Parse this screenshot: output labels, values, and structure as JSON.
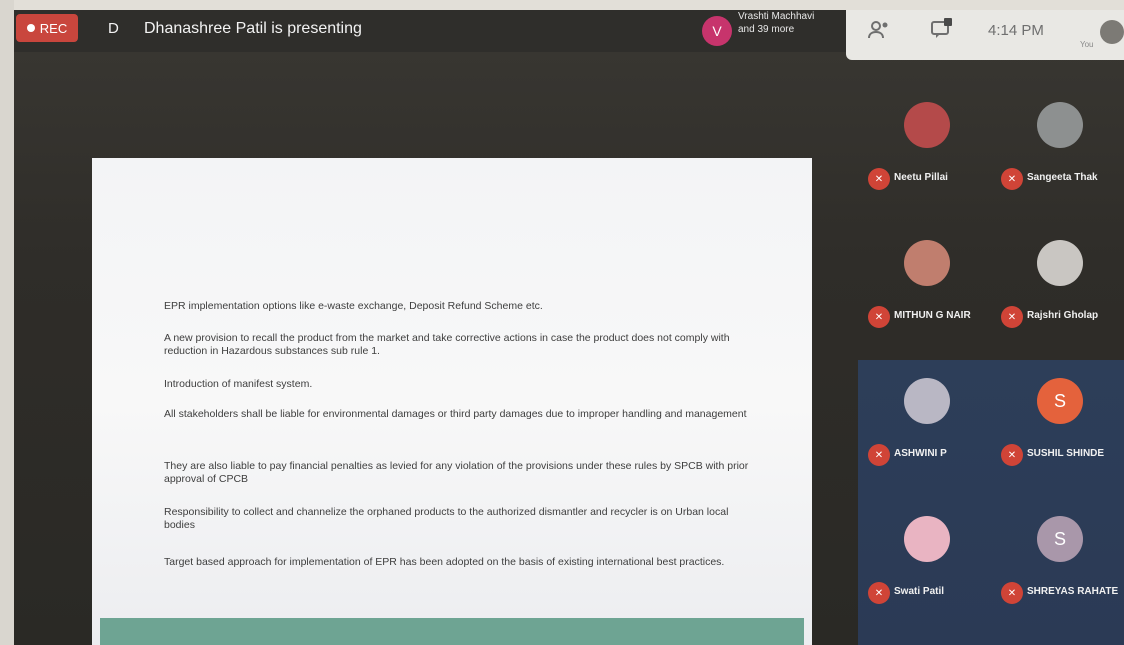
{
  "topbar": {
    "rec_label": "REC",
    "presenter_initial": "D",
    "presenting_text": "Dhanashree Patil is presenting",
    "other_avatar_letter": "V",
    "others_line1": "Vrashti Machhavi",
    "others_line2": "and 39 more"
  },
  "status": {
    "time": "4:14 PM",
    "you_label": "You"
  },
  "slide": {
    "bullets": [
      "EPR implementation options like e-waste exchange, Deposit Refund Scheme etc.",
      "A new provision to recall the product from the market and take corrective actions in case the product does not comply with reduction in Hazardous substances sub rule 1.",
      "Introduction of manifest system.",
      "All stakeholders shall be liable for environmental damages or third party damages due to improper handling and management",
      "They are also liable to pay financial penalties as levied for any violation of the provisions under these rules by SPCB with prior approval of CPCB",
      "Responsibility to collect and channelize the orphaned products to the authorized dismantler and recycler is on Urban local bodies",
      "Target based approach for implementation of EPR has been adopted on the basis of existing international best practices."
    ]
  },
  "participants": [
    {
      "name": "Neetu Pillai",
      "initial": "",
      "color": "#b44a4a"
    },
    {
      "name": "Sangeeta Thak",
      "initial": "",
      "color": "#8d9090"
    },
    {
      "name": "MITHUN G NAIR",
      "initial": "",
      "color": "#c07e6e"
    },
    {
      "name": "Rajshri Gholap",
      "initial": "",
      "color": "#c9c6c2"
    },
    {
      "name": "ASHWINI P",
      "initial": "",
      "color": "#b9b7c4"
    },
    {
      "name": "SUSHIL SHINDE",
      "initial": "S",
      "color": "#e4623c"
    },
    {
      "name": "Swati Patil",
      "initial": "",
      "color": "#e9b4c2"
    },
    {
      "name": "SHREYAS RAHATE",
      "initial": "S",
      "color": "#a997aa"
    }
  ]
}
